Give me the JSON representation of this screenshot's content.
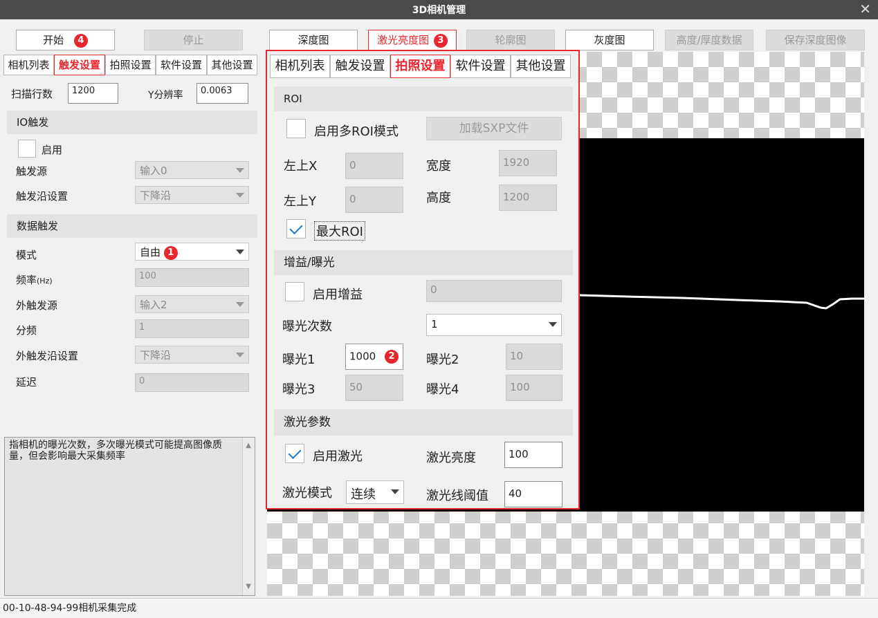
{
  "window": {
    "title": "3D相机管理",
    "close_glyph": "✕"
  },
  "toolbar": {
    "start": "开始",
    "start_badge": "4",
    "stop": "停止",
    "depth_map": "深度图",
    "laser_brightness_map": "激光亮度图",
    "laser_badge": "3",
    "contour_map": "轮廓图",
    "gray_map": "灰度图",
    "height_thickness": "高度/厚度数据",
    "save_depth": "保存深度图像"
  },
  "left": {
    "tabs": [
      "相机列表",
      "触发设置",
      "拍照设置",
      "软件设置",
      "其他设置"
    ],
    "active_tab": 1,
    "scan_rows_label": "扫描行数",
    "scan_rows_value": "1200",
    "y_res_label": "Y分辨率",
    "y_res_value": "0.0063",
    "io_section": "IO触发",
    "enable_label": "启用",
    "trigger_source_label": "触发源",
    "trigger_source_value": "输入0",
    "trigger_edge_label": "触发沿设置",
    "trigger_edge_value": "下降沿",
    "data_section": "数据触发",
    "mode_label": "模式",
    "mode_value": "自由",
    "mode_badge": "1",
    "freq_label": "频率",
    "freq_unit": "(Hz)",
    "freq_value": "100",
    "ext_source_label": "外触发源",
    "ext_source_value": "输入2",
    "divider_label": "分频",
    "divider_value": "1",
    "ext_edge_label": "外触发沿设置",
    "ext_edge_value": "下降沿",
    "delay_label": "延迟",
    "delay_value": "0",
    "help_text": "指相机的曝光次数，多次曝光模式可能提高图像质量，但会影响最大采集频率"
  },
  "overlay": {
    "tabs": [
      "相机列表",
      "触发设置",
      "拍照设置",
      "软件设置",
      "其他设置"
    ],
    "active_tab": 2,
    "roi_section": "ROI",
    "multi_roi_label": "启用多ROI模式",
    "load_sxp": "加载SXP文件",
    "top_left_x_label": "左上X",
    "top_left_x_value": "0",
    "width_label": "宽度",
    "width_value": "1920",
    "top_left_y_label": "左上Y",
    "top_left_y_value": "0",
    "height_label": "高度",
    "height_value": "1200",
    "max_roi_label": "最大ROI",
    "gain_section": "增益/曝光",
    "enable_gain_label": "启用增益",
    "gain_value": "0",
    "exposure_count_label": "曝光次数",
    "exposure_count_value": "1",
    "exp1_label": "曝光1",
    "exp1_value": "1000",
    "exp1_badge": "2",
    "exp2_label": "曝光2",
    "exp2_value": "10",
    "exp3_label": "曝光3",
    "exp3_value": "50",
    "exp4_label": "曝光4",
    "exp4_value": "100",
    "laser_section": "激光参数",
    "enable_laser_label": "启用激光",
    "laser_brightness_label": "激光亮度",
    "laser_brightness_value": "100",
    "laser_mode_label": "激光模式",
    "laser_mode_value": "连续",
    "laser_threshold_label": "激光线阈值",
    "laser_threshold_value": "40"
  },
  "status": {
    "text": "00-10-48-94-99相机采集完成"
  }
}
